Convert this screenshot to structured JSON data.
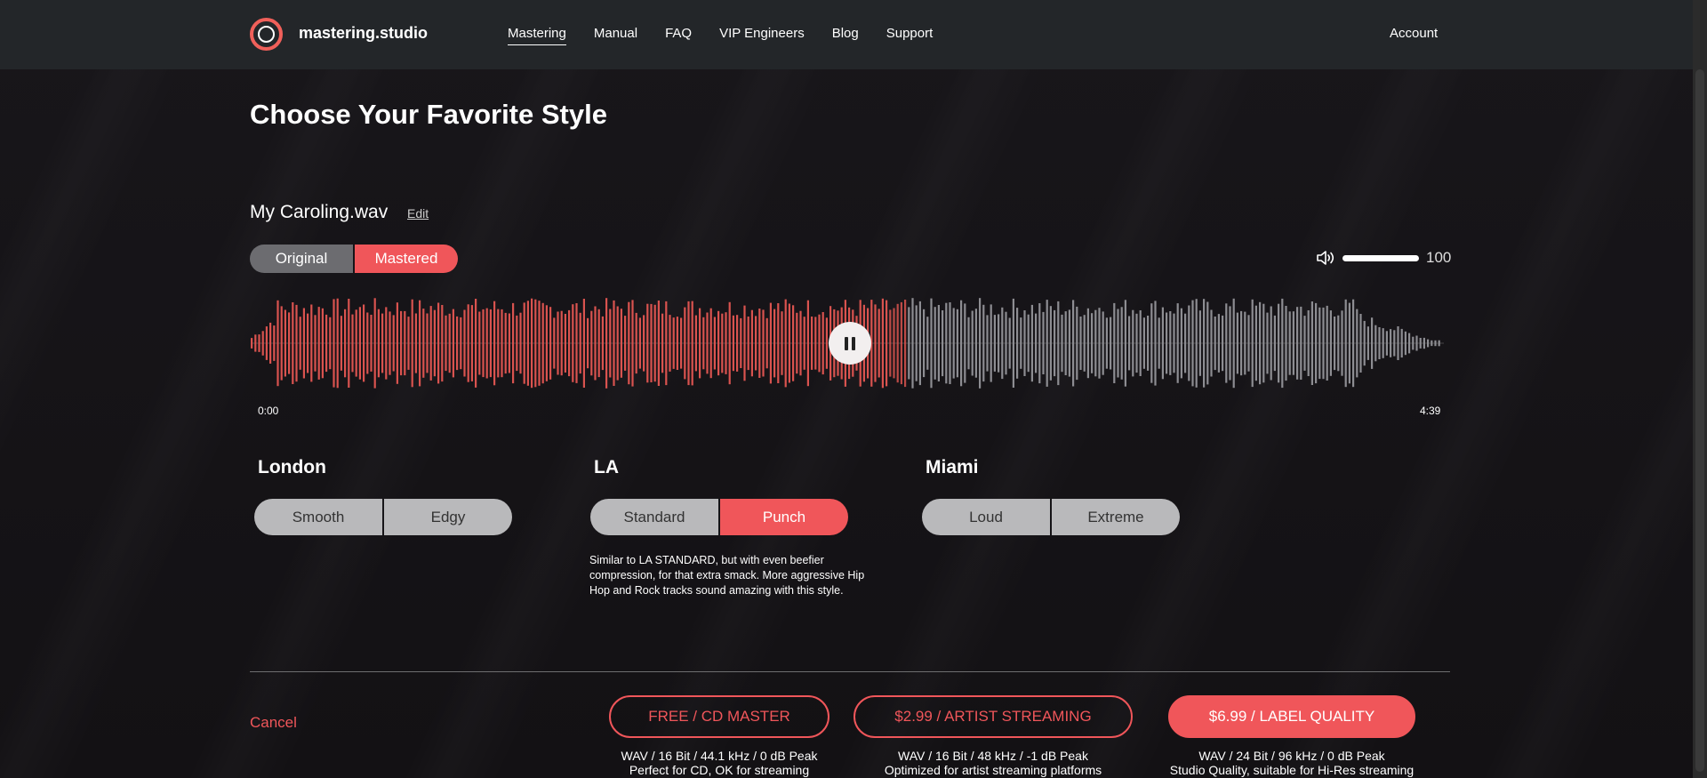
{
  "header": {
    "brand": "mastering.studio",
    "nav": [
      "Mastering",
      "Manual",
      "FAQ",
      "VIP Engineers",
      "Blog",
      "Support"
    ],
    "account": "Account"
  },
  "page": {
    "title": "Choose Your Favorite Style"
  },
  "track": {
    "filename": "My Caroling.wav",
    "edit_label": "Edit",
    "toggle": {
      "original": "Original",
      "mastered": "Mastered"
    },
    "volume": "100",
    "time_start": "0:00",
    "time_end": "4:39",
    "progress": 0.55
  },
  "styles": {
    "london": {
      "label": "London",
      "options": [
        "Smooth",
        "Edgy"
      ]
    },
    "la": {
      "label": "LA",
      "options": [
        "Standard",
        "Punch"
      ]
    },
    "miami": {
      "label": "Miami",
      "options": [
        "Loud",
        "Extreme"
      ]
    },
    "description": "Similar to LA STANDARD, but with even beefier compression, for that extra smack. More aggressive Hip Hop and Rock tracks sound amazing with this style."
  },
  "footer": {
    "cancel": "Cancel",
    "tiers": [
      {
        "label": "FREE / CD MASTER",
        "spec": "WAV / 16 Bit / 44.1 kHz / 0 dB Peak",
        "note": "Perfect for CD, OK for streaming"
      },
      {
        "label": "$2.99 / ARTIST STREAMING",
        "spec": "WAV / 16 Bit / 48 kHz / -1 dB Peak",
        "note": "Optimized for artist streaming platforms"
      },
      {
        "label": "$6.99 / LABEL QUALITY",
        "spec": "WAV / 24 Bit / 96 kHz / 0 dB Peak",
        "note": "Studio Quality, suitable for Hi-Res streaming"
      }
    ]
  },
  "colors": {
    "accent": "#f0565a",
    "played_wave": "#d9534f",
    "unplayed_wave": "#8d8d92"
  }
}
